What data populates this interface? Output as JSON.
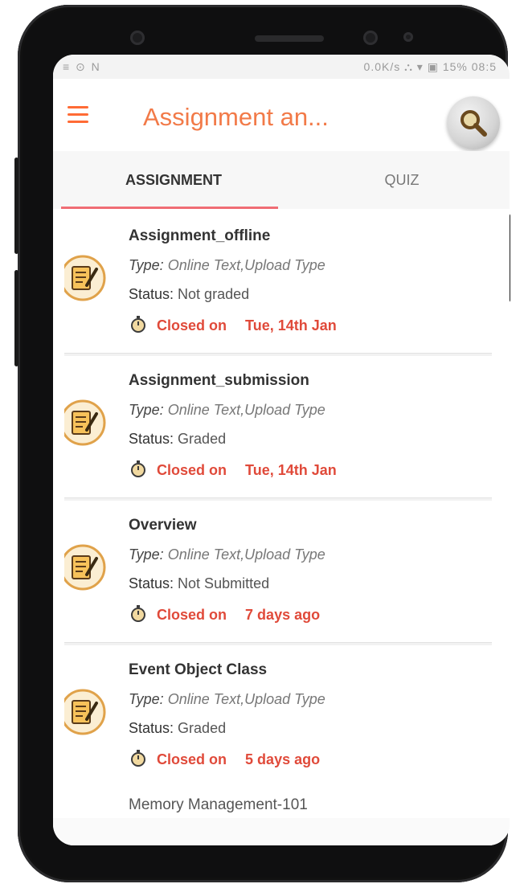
{
  "status_bar": {
    "left": "≡ ⊙ N",
    "right": "0.0K/s ⛬ ▾ ▣ 15% 08:5"
  },
  "app_bar": {
    "title": "Assignment an...",
    "menu_icon": "menu-icon",
    "search_icon": "search-icon"
  },
  "tabs": [
    {
      "label": "ASSIGNMENT",
      "selected": true
    },
    {
      "label": "QUIZ",
      "selected": false
    }
  ],
  "assignments": [
    {
      "title": "Assignment_offline",
      "type_label": "Type:",
      "type_value": "Online Text,Upload Type",
      "status_label": "Status:",
      "status_value": "Not graded",
      "closed_label": "Closed on",
      "closed_value": "Tue, 14th  Jan"
    },
    {
      "title": "Assignment_submission",
      "type_label": "Type:",
      "type_value": "Online Text,Upload Type",
      "status_label": "Status:",
      "status_value": "Graded",
      "closed_label": "Closed on",
      "closed_value": "Tue, 14th  Jan"
    },
    {
      "title": "Overview",
      "type_label": "Type:",
      "type_value": "Online Text,Upload Type",
      "status_label": "Status:",
      "status_value": "Not Submitted",
      "closed_label": "Closed on",
      "closed_value": "7 days ago"
    },
    {
      "title": "Event Object Class",
      "type_label": "Type:",
      "type_value": "Online Text,Upload Type",
      "status_label": "Status:",
      "status_value": "Graded",
      "closed_label": "Closed on",
      "closed_value": "5 days ago"
    }
  ],
  "partial_item": {
    "title": "Memory Management-101"
  },
  "colors": {
    "accent": "#f27a48",
    "menu": "#ff6b35",
    "tab_indicator": "#f06d75",
    "due_text": "#e04a3a"
  }
}
